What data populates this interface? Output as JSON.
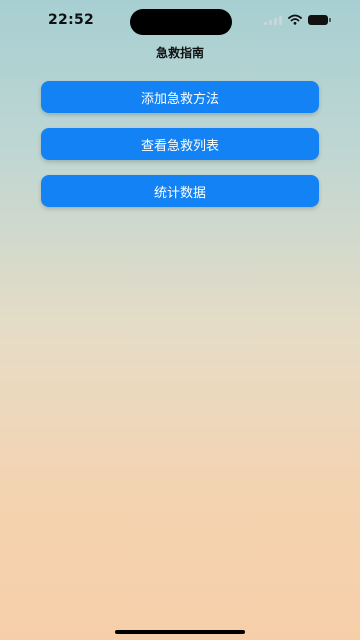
{
  "status_bar": {
    "time": "22:52",
    "icons": [
      "cellular-signal-icon",
      "wifi-icon",
      "battery-icon"
    ]
  },
  "nav": {
    "title": "急救指南"
  },
  "buttons": {
    "add_method": "添加急救方法",
    "view_list": "查看急救列表",
    "statistics": "统计数据"
  },
  "colors": {
    "button_bg": "#1282f5",
    "button_text": "#ffffff",
    "background_top": "#a7cfd2",
    "background_bottom": "#f6cfa9"
  }
}
